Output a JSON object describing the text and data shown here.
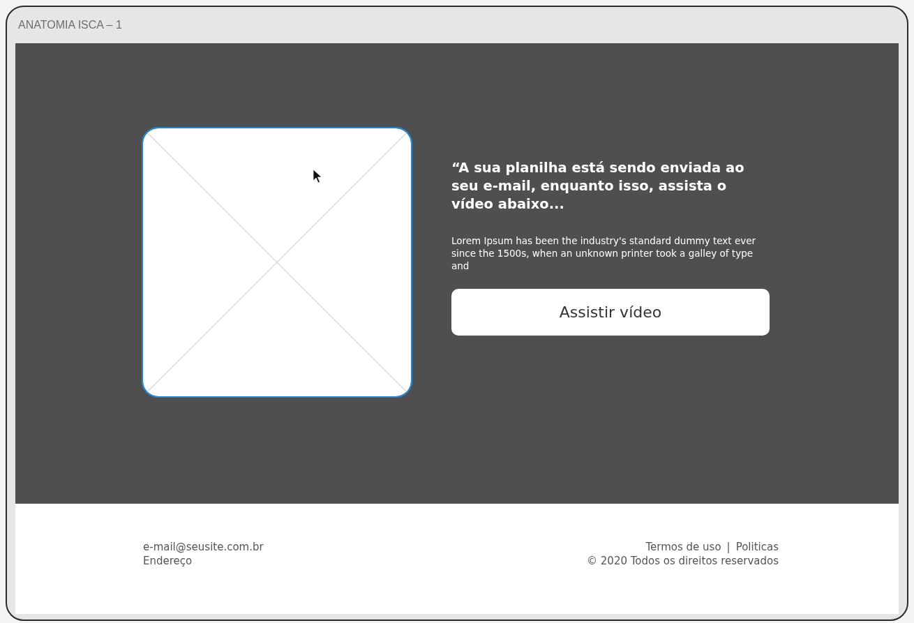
{
  "window": {
    "title": "ANATOMIA ISCA – 1"
  },
  "hero": {
    "image_placeholder": {
      "selected": true
    },
    "quote": "“A sua planilha está sendo enviada ao seu e-mail, enquanto isso, assista o vídeo abaixo...",
    "paragraph": "Lorem Ipsum has been the industry's standard dummy text ever since the 1500s, when an unknown printer took a galley of type and",
    "button": "Assistir vídeo"
  },
  "footer": {
    "email": "e-mail@seusite.com.br",
    "address": "Endereço",
    "links": [
      "Termos de uso",
      "Politicas"
    ],
    "separator": "|",
    "copyright": "© 2020 Todos os direitos reservados"
  }
}
